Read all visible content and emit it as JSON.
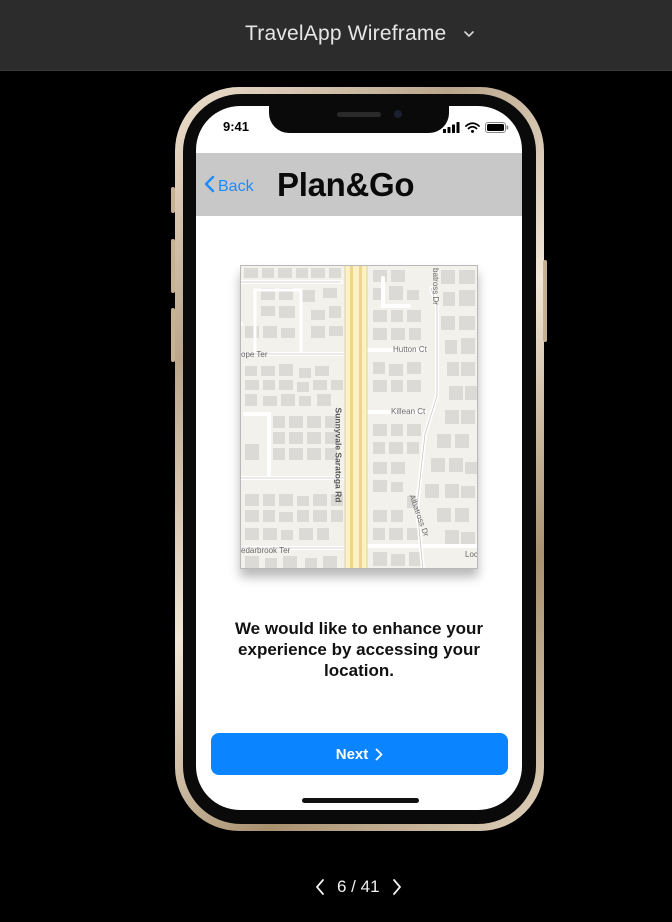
{
  "header": {
    "title": "TravelApp Wireframe",
    "dropdown_icon": "chevron-down-icon"
  },
  "phone": {
    "status_bar": {
      "time": "9:41",
      "icons": [
        "signal-icon",
        "wifi-icon",
        "battery-icon"
      ]
    },
    "nav_bar": {
      "back_label": "Back",
      "title": "Plan&Go"
    },
    "map": {
      "labels": {
        "main_road": "Sunnyvale Saratoga Rd",
        "hutton": "Hutton Ct",
        "killean": "Killean Ct",
        "albatross": "Albatross Dr",
        "albatross_top": "batross Dr",
        "hope": "ope Ter",
        "cedarbrook": "edarbrook Ter",
        "loc": "Loc"
      }
    },
    "message": "We would like to enhance your experience by accessing your location.",
    "next_button": {
      "label": "Next",
      "icon": "chevron-right-icon"
    }
  },
  "pager": {
    "text": "6 / 41",
    "prev_icon": "chevron-left-icon",
    "next_icon": "chevron-right-icon"
  },
  "colors": {
    "topbar_bg": "#2c2c2c",
    "navbar_bg": "#c8c8c8",
    "accent_blue": "#0a84ff",
    "back_blue": "#1a8cff"
  }
}
